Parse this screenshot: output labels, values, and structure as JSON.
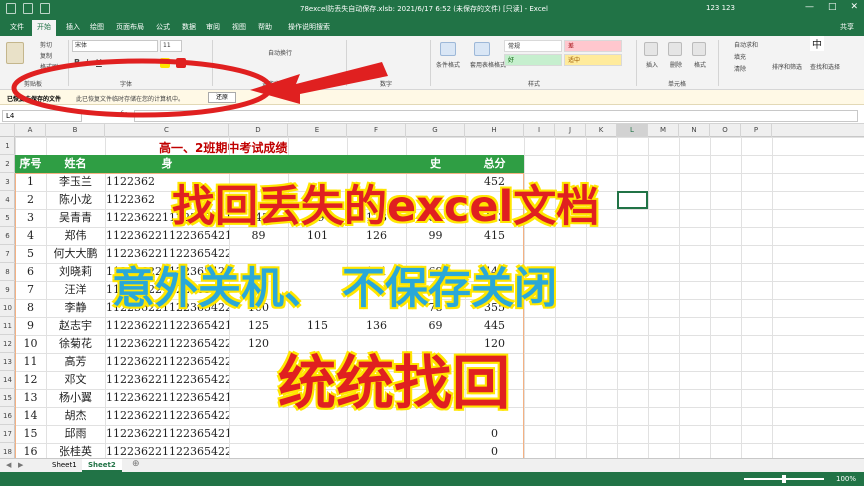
{
  "titlebar": {
    "title": "78excel防丢失自动保存.xlsb: 2021/6/17 6:52 (未保存的文件) [只读] - Excel",
    "user": "123 123",
    "min": "—",
    "max": "□",
    "close": "✕"
  },
  "tabs": [
    "文件",
    "开始",
    "插入",
    "绘图",
    "页面布局",
    "公式",
    "数据",
    "审阅",
    "视图",
    "帮助",
    "操作说明搜索"
  ],
  "share": "共享",
  "ribbon": {
    "clipboard": {
      "cut": "剪切",
      "copy": "复制",
      "format_painter": "格式刷",
      "group": "剪贴板"
    },
    "font": {
      "name": "宋体",
      "size": "11",
      "group": "字体"
    },
    "alignment": {
      "wrap": "自动换行",
      "group": "对齐方式"
    },
    "number": {
      "group": "数字"
    },
    "styles": {
      "conditional": "条件格式",
      "table": "套用表格格式",
      "normal": "常规",
      "bad": "差",
      "good": "好",
      "neutral": "适中",
      "group": "样式",
      "bad_color": "#ffc7ce",
      "good_color": "#c6efce",
      "neutral_color": "#ffeb9c"
    },
    "cells": {
      "insert": "插入",
      "delete": "删除",
      "format": "格式",
      "group": "单元格"
    },
    "editing": {
      "autosum": "自动求和",
      "fill": "填充",
      "clear": "清除",
      "sort": "排序和筛选",
      "find": "查找和选择"
    },
    "ime": "中"
  },
  "msgbar": {
    "title": "已恢复未保存的文件",
    "text": "此已恢复文件临时存储在您的计算机中。",
    "button": "还原"
  },
  "formula": {
    "namebox": "L4",
    "fx": "fx",
    "value": ""
  },
  "columns": [
    "A",
    "B",
    "C",
    "D",
    "E",
    "F",
    "G",
    "H",
    "I",
    "J",
    "K",
    "L",
    "M",
    "N",
    "O",
    "P"
  ],
  "selected_column": "L",
  "rows": [
    "1",
    "2",
    "3",
    "4",
    "5",
    "6",
    "7",
    "8",
    "9",
    "10",
    "11",
    "12",
    "13",
    "14",
    "15",
    "16",
    "17",
    "18"
  ],
  "sheet": {
    "title": "高一、2班期中考试成绩",
    "headers": [
      "序号",
      "姓名",
      "身",
      "",
      "",
      "",
      "史",
      "总分"
    ],
    "records": [
      {
        "no": "1",
        "name": "李玉兰",
        "id": "1122362",
        "d": "",
        "e": "",
        "f": "",
        "g": "",
        "total": "452"
      },
      {
        "no": "2",
        "name": "陈小龙",
        "id": "1122362",
        "d": "",
        "e": "",
        "f": "",
        "g": "",
        "total": ""
      },
      {
        "no": "3",
        "name": "吴青青",
        "id": "112236221122365421",
        "d": "143",
        "e": "99",
        "f": "123",
        "g": "88",
        "total": "453"
      },
      {
        "no": "4",
        "name": "郑伟",
        "id": "112236221122365421",
        "d": "89",
        "e": "101",
        "f": "126",
        "g": "99",
        "total": "415"
      },
      {
        "no": "5",
        "name": "何大大鹏",
        "id": "112236221122365422",
        "d": "",
        "e": "",
        "f": "",
        "g": "",
        "total": ""
      },
      {
        "no": "6",
        "name": "刘晓莉",
        "id": "112236221122365421",
        "d": "",
        "e": "",
        "f": "121",
        "g": "69",
        "total": "443"
      },
      {
        "no": "7",
        "name": "汪洋",
        "id": "112236221122365422",
        "d": "",
        "e": "",
        "f": "",
        "g": "",
        "total": ""
      },
      {
        "no": "8",
        "name": "李静",
        "id": "112236221122365422",
        "d": "100",
        "e": "",
        "f": "",
        "g": "78",
        "total": "355"
      },
      {
        "no": "9",
        "name": "赵志宇",
        "id": "112236221122365421",
        "d": "125",
        "e": "115",
        "f": "136",
        "g": "69",
        "total": "445"
      },
      {
        "no": "10",
        "name": "徐菊花",
        "id": "112236221122365422",
        "d": "120",
        "e": "",
        "f": "",
        "g": "",
        "total": "120"
      },
      {
        "no": "11",
        "name": "高芳",
        "id": "112236221122365422",
        "d": "",
        "e": "",
        "f": "",
        "g": "",
        "total": ""
      },
      {
        "no": "12",
        "name": "邓文",
        "id": "112236221122365422",
        "d": "",
        "e": "",
        "f": "",
        "g": "",
        "total": ""
      },
      {
        "no": "13",
        "name": "杨小翼",
        "id": "112236221122365421",
        "d": "",
        "e": "",
        "f": "",
        "g": "",
        "total": ""
      },
      {
        "no": "14",
        "name": "胡杰",
        "id": "112236221122365422",
        "d": "",
        "e": "",
        "f": "",
        "g": "",
        "total": ""
      },
      {
        "no": "15",
        "name": "邱雨",
        "id": "112236221122365421",
        "d": "",
        "e": "",
        "f": "",
        "g": "",
        "total": "0"
      },
      {
        "no": "16",
        "name": "张桂英",
        "id": "112236221122365422",
        "d": "",
        "e": "",
        "f": "",
        "g": "",
        "total": "0"
      }
    ]
  },
  "sheettabs": [
    "Sheet1",
    "Sheet2"
  ],
  "active_sheet": "Sheet2",
  "add_sheet": "⊕",
  "status": {
    "zoom": "100%"
  },
  "overlay": {
    "line1": "找回丢失的excel文档",
    "line2": "意外关机、 不保存关闭",
    "line3": "统统找回",
    "red": "#e02020",
    "blue": "#2aa8d8",
    "outline": "#ffe600"
  }
}
